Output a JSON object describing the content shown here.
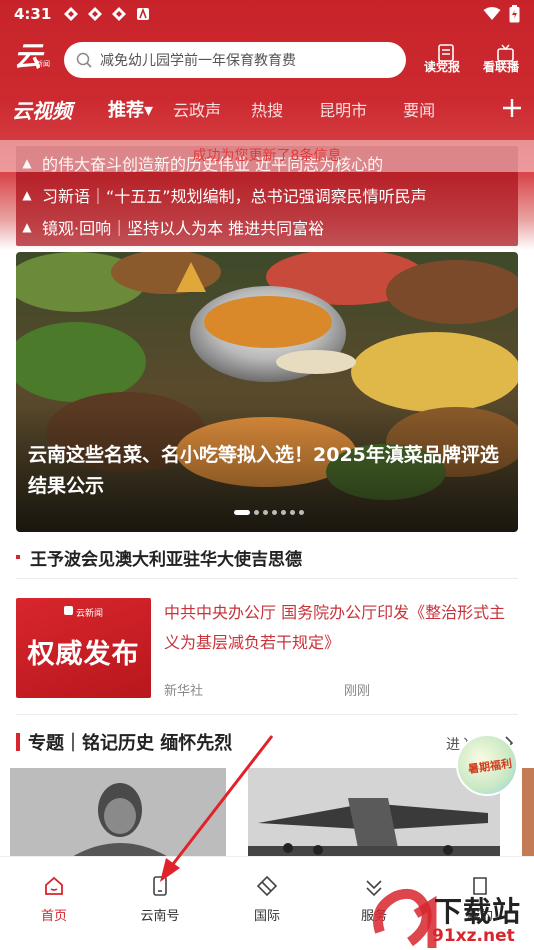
{
  "status_bar": {
    "time": "4:31"
  },
  "header": {
    "logo_text": "云",
    "logo_sub": "新闻",
    "search_placeholder": "减免幼儿园学前一年保育教育费",
    "read_party_label": "读党报",
    "watch_broadcast_label": "看联播"
  },
  "tabs": {
    "video_label": "云视频",
    "items": [
      {
        "label": "推荐▾",
        "active": true
      },
      {
        "label": "云政声",
        "active": false
      },
      {
        "label": "热搜",
        "active": false
      },
      {
        "label": "昆明市",
        "active": false
      },
      {
        "label": "要闻",
        "active": false
      }
    ]
  },
  "toast": "成功为您更新了8条信息",
  "ticker": [
    "的伟大奋斗创造新的历史伟业 近平同志为核心的",
    "习新语｜“十五五”规划编制，总书记强调察民情听民声",
    "镜观·回响｜坚持以人为本 推进共同富裕"
  ],
  "hero": {
    "title": "云南这些名菜、名小吃等拟入选！2025年滇菜品牌评选结果公示"
  },
  "headline": "王予波会见澳大利亚驻华大使吉思德",
  "article": {
    "thumb_brand": "云新闻",
    "thumb_text": "权威发布",
    "title": "中共中央办公厅 国务院办公厅印发《整治形式主义为基层减负若干规定》",
    "source": "新华社",
    "time": "刚刚"
  },
  "topic": {
    "title": "专题｜铭记历史 缅怀先烈",
    "more": "进入"
  },
  "badge_text": "暑期福利",
  "bottom_nav": [
    {
      "label": "首页",
      "icon": "home-icon",
      "active": true
    },
    {
      "label": "云南号",
      "icon": "phone-icon",
      "active": false
    },
    {
      "label": "国际",
      "icon": "globe-icon",
      "active": false
    },
    {
      "label": "服务",
      "icon": "service-icon",
      "active": false
    },
    {
      "label": "我的",
      "icon": "user-icon",
      "active": false
    }
  ],
  "watermark": {
    "text": "下载站",
    "url": "91xz.net"
  },
  "colors": {
    "brand_red": "#c8232a",
    "accent_red": "#d7262d",
    "link_red": "#c8333a"
  }
}
